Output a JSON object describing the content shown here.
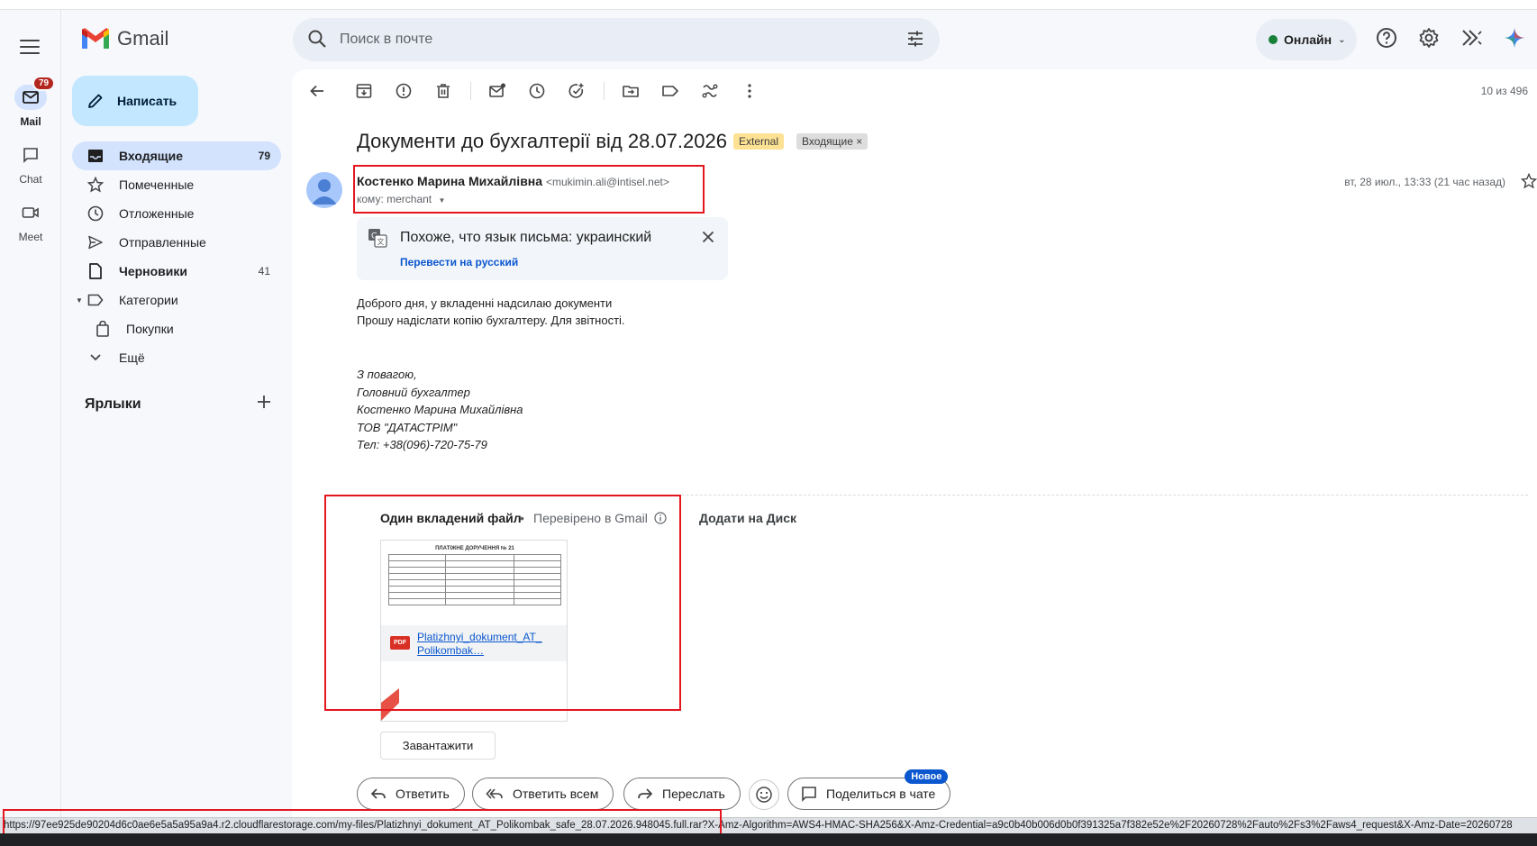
{
  "app": {
    "name": "Gmail"
  },
  "rail": {
    "mail_label": "Mail",
    "mail_badge": "79",
    "chat_label": "Chat",
    "meet_label": "Meet"
  },
  "search": {
    "placeholder": "Поиск в почте"
  },
  "header": {
    "status_label": "Онлайн"
  },
  "compose": {
    "label": "Написать"
  },
  "nav": {
    "items": [
      {
        "label": "Входящие",
        "count": "79"
      },
      {
        "label": "Помеченные",
        "count": ""
      },
      {
        "label": "Отложенные",
        "count": ""
      },
      {
        "label": "Отправленные",
        "count": ""
      },
      {
        "label": "Черновики",
        "count": "41"
      },
      {
        "label": "Категории",
        "count": ""
      },
      {
        "label": "Покупки",
        "count": ""
      },
      {
        "label": "Ещё",
        "count": ""
      }
    ],
    "labels_title": "Ярлыки"
  },
  "toolbar": {
    "pager": "10 из 496"
  },
  "email": {
    "subject": "Документи до бухгалтерії від 28.07.2026",
    "tag_external": "External",
    "tag_inbox": "Входящие ×",
    "sender_name": "Костенко Марина Михайлівна",
    "sender_email": "<mukimin.ali@intisel.net>",
    "to_line": "кому: merchant",
    "date": "вт, 28 июл., 13:33 (21 час назад)",
    "translate_text": "Похоже, что язык письма: украинский",
    "translate_link": "Перевести на русский",
    "body": [
      "Доброго дня, у вкладенні надсилаю документи",
      "Прошу надіслати копію бухгалтеру. Для звітності."
    ],
    "signature": [
      "З повагою,",
      "Головний бухгалтер",
      "Костенко Марина Михайлівна",
      "ТОВ \"ДАТАСТРІМ\"",
      "Тел: +38(096)-720-75-79"
    ]
  },
  "attachment": {
    "title": "Один вкладений файл",
    "dot": "•",
    "verified": "Перевірено в Gmail",
    "add_drive": "Додати на Диск",
    "thumb_title": "ПЛАТІЖНЕ ДОРУЧЕННЯ № 21",
    "type_badge": "PDF",
    "filename": "Platizhnyi_dokument_AT_ Polikombak…",
    "download": "Завантажити"
  },
  "actions": {
    "reply": "Ответить",
    "reply_all": "Ответить всем",
    "forward": "Переслать",
    "share_chat": "Поделиться в чате",
    "new_badge": "Новое"
  },
  "statusbar": {
    "url": "https://97ee925de90204d6c0ae6e5a5a95a9a4.r2.cloudflarestorage.com/my-files/Platizhnyi_dokument_AT_Polikombak_safe_28.07.2026.948045.full.rar?X-Amz-Algorithm=AWS4-HMAC-SHA256&X-Amz-Credential=a9c0b40b006d0b0f391325a7f382e52e%2F20260728%2Fauto%2Fs3%2Faws4_request&X-Amz-Date=20260728"
  },
  "colors": {
    "accent": "#0b57d0",
    "compose_bg": "#c2e7ff",
    "active_nav": "#d3e3fd",
    "highlight_box": "#e4161e",
    "online": "#188038"
  }
}
